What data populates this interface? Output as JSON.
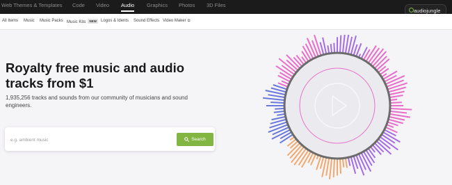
{
  "topnav": {
    "items": [
      {
        "label": "Web Themes & Templates",
        "active": false
      },
      {
        "label": "Code",
        "active": false
      },
      {
        "label": "Video",
        "active": false
      },
      {
        "label": "Audio",
        "active": true
      },
      {
        "label": "Graphics",
        "active": false
      },
      {
        "label": "Photos",
        "active": false
      },
      {
        "label": "3D Files",
        "active": false
      }
    ],
    "brand": "audiojungle"
  },
  "subnav": {
    "items": [
      {
        "label": "All Items"
      },
      {
        "label": "Music"
      },
      {
        "label": "Music Packs"
      },
      {
        "label": "Music Kits",
        "badge": "NEW"
      },
      {
        "label": "Logos & Idents"
      },
      {
        "label": "Sound Effects"
      },
      {
        "label": "Video Maker",
        "icon": "external-link-icon"
      }
    ]
  },
  "hero": {
    "title": "Royalty free music and audio tracks from $1",
    "subtitle": "1,935,256 tracks and sounds from our community of musicians and sound engineers."
  },
  "search": {
    "placeholder": "e.g. ambient music",
    "value": "",
    "button_label": "Search",
    "button_icon": "search-icon"
  },
  "visual": {
    "play_icon": "play-icon",
    "colors": {
      "pink": "#e86ec9",
      "purple": "#a46de3",
      "blue": "#6a78dc",
      "orange": "#f0a96e",
      "accent": "#82b541"
    }
  }
}
